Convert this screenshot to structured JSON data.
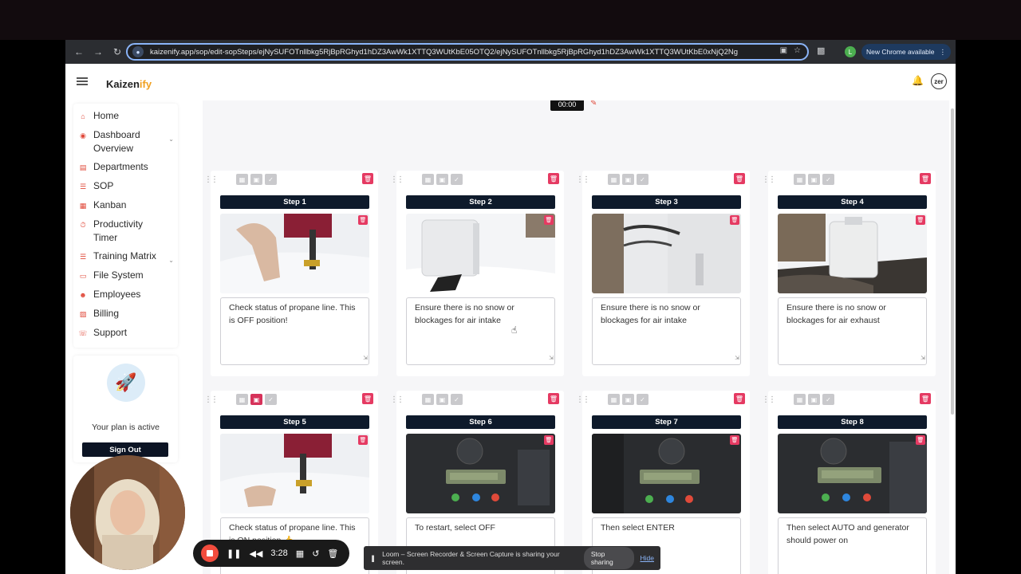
{
  "browser": {
    "url": "kaizenify.app/sop/edit-sopSteps/ejNySUFOTnllbkg5RjBpRGhyd1hDZ3AwWk1XTTQ3WUtKbE05OTQ2/ejNySUFOTnllbkg5RjBpRGhyd1hDZ3AwWk1XTTQ3WUtKbE0xNjQ2Ng",
    "profile_initial": "L",
    "update_label": "New Chrome available"
  },
  "app": {
    "logo_main": "Kaizen",
    "logo_accent": "ify",
    "user_initials": "zer",
    "timer": "00:00"
  },
  "sidebar": {
    "items": [
      {
        "label": "Home",
        "icon": "home-icon"
      },
      {
        "label": "Dashboard Overview",
        "icon": "dashboard-icon",
        "has_chevron": true
      },
      {
        "label": "Departments",
        "icon": "departments-icon"
      },
      {
        "label": "SOP",
        "icon": "list-icon"
      },
      {
        "label": "Kanban",
        "icon": "kanban-icon"
      },
      {
        "label": "Productivity Timer",
        "icon": "timer-icon"
      },
      {
        "label": "Training Matrix",
        "icon": "matrix-icon",
        "has_chevron": true
      },
      {
        "label": "File System",
        "icon": "file-icon"
      },
      {
        "label": "Employees",
        "icon": "employees-icon"
      },
      {
        "label": "Billing",
        "icon": "billing-icon"
      },
      {
        "label": "Support",
        "icon": "support-icon"
      }
    ],
    "plan_text": "Your plan is active",
    "sign_out": "Sign Out"
  },
  "steps": [
    {
      "label": "Step 1",
      "text": "Check status of propane line. This is OFF position!",
      "active_view": -1
    },
    {
      "label": "Step 2",
      "text": "Ensure there is no snow or blockages for air intake",
      "active_view": -1
    },
    {
      "label": "Step 3",
      "text": "Ensure there is no snow or blockages for air intake",
      "active_view": -1
    },
    {
      "label": "Step 4",
      "text": "Ensure there is no snow or blockages for air exhaust",
      "active_view": -1
    },
    {
      "label": "Step 5",
      "text": "Check status of propane line. This is ON position 👍",
      "active_view": 1
    },
    {
      "label": "Step 6",
      "text": "To restart, select OFF",
      "active_view": -1
    },
    {
      "label": "Step 7",
      "text": "Then select ENTER",
      "active_view": -1
    },
    {
      "label": "Step 8",
      "text": "Then select AUTO and generator should power on",
      "active_view": -1
    }
  ],
  "recorder": {
    "elapsed": "3:28"
  },
  "share_bar": {
    "message": "Loom – Screen Recorder & Screen Capture is sharing your screen.",
    "stop_label": "Stop sharing",
    "hide_label": "Hide"
  },
  "colors": {
    "accent": "#e0493a",
    "delete": "#e53a62",
    "step_bar": "#0e1a2b"
  }
}
